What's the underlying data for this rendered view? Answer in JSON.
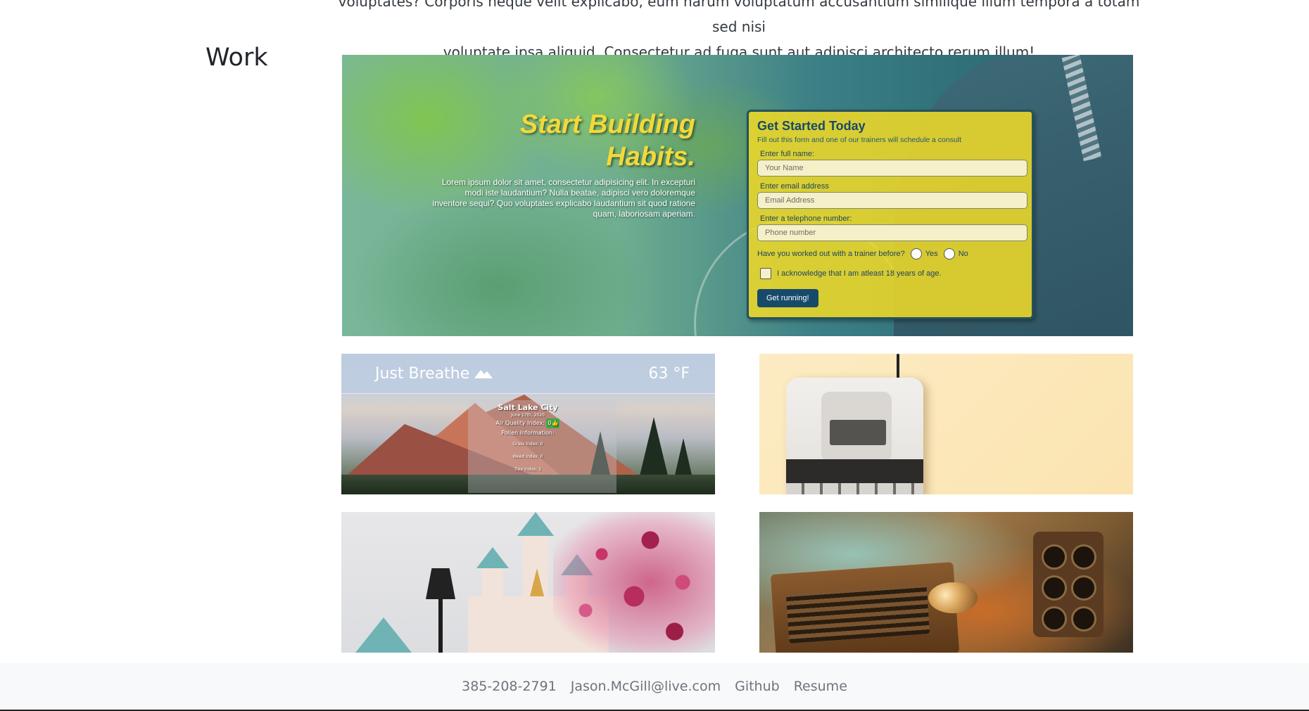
{
  "intro": {
    "line1": "voluptates? Corporis neque velit explicabo, eum harum voluptatum accusantium similique illum tempora a totam sed nisi",
    "line2": "voluptate ipsa aliquid. Consectetur ad fuga sunt aut adipisci architecto rerum illum!"
  },
  "work": {
    "heading": "Work"
  },
  "hero": {
    "title_line1": "Start Building",
    "title_line2": "Habits.",
    "body": "Lorem ipsum dolor sit amet, consectetur adipisicing elit. In excepturi modi iste laudantium? Nulla beatae, adipisci vero doloremque inventore sequi? Quo voluptates explicabo laudantium sit quod ratione quam, laboriosam aperiam.",
    "form": {
      "title": "Get Started Today",
      "subtitle": "Fill out this form and one of our trainers will schedule a consult",
      "name_label": "Enter full name:",
      "name_placeholder": "Your Name",
      "email_label": "Enter email address",
      "email_placeholder": "Email Address",
      "phone_label": "Enter a telephone number:",
      "phone_placeholder": "Phone number",
      "trainer_question": "Have you worked out with a trainer before?",
      "yes_label": "Yes",
      "no_label": "No",
      "age_ack": "I acknowledge that I am atleast 18 years of age.",
      "submit_label": "Get running!"
    }
  },
  "weather": {
    "brand": "Just Breathe",
    "temp": "63 °F",
    "city": "Salt Lake City",
    "date": "June 17th, 2020",
    "aqi_label": "Air Quality Index:",
    "aqi_value": "0",
    "pollen_label": "Pollen Information:",
    "grass": "Grass Index: 0",
    "weed": "Weed Index: 0",
    "tree": "Tree Index: 1"
  },
  "footer": {
    "phone": "385-208-2791",
    "email": "Jason.McGill@live.com",
    "github": "Github",
    "resume": "Resume"
  }
}
